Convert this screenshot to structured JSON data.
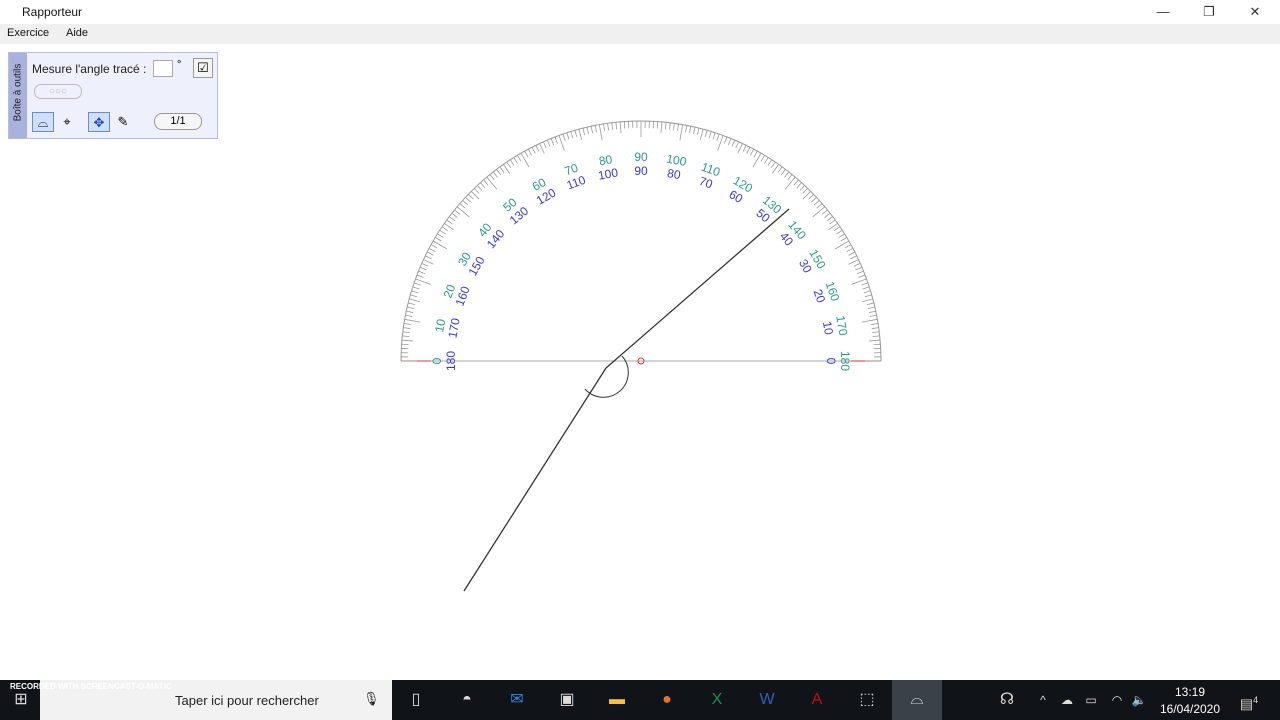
{
  "window": {
    "title": "Rapporteur",
    "minimize": "—",
    "restore": "❐",
    "close": "✕"
  },
  "menu": [
    {
      "label": "Exercice"
    },
    {
      "label": "Aide"
    }
  ],
  "toolbox": {
    "side_label": "Boîte à outils",
    "prompt": "Mesure l'angle tracé :",
    "angle_value": "",
    "degree": "°",
    "validate_icon": "checkbox-icon",
    "dots": "○○○",
    "page": "1/1"
  },
  "protractor": {
    "outer_labels": [
      0,
      10,
      20,
      30,
      40,
      50,
      60,
      70,
      80,
      90,
      100,
      110,
      120,
      130,
      140,
      150,
      160,
      170,
      180
    ],
    "inner_labels": [
      180,
      170,
      160,
      150,
      140,
      130,
      120,
      110,
      100,
      90,
      80,
      70,
      60,
      50,
      40,
      30,
      20,
      10,
      0
    ],
    "outer_color": "#2a9a8a",
    "inner_color": "#3a3acc",
    "accent": "#e03030"
  },
  "taskbar": {
    "search_placeholder": "Taper ici pour rechercher",
    "time": "13:19",
    "date": "16/04/2020",
    "notifications": "4",
    "watermark": "RECORDED WITH SCREENCAST-O-MATIC"
  }
}
